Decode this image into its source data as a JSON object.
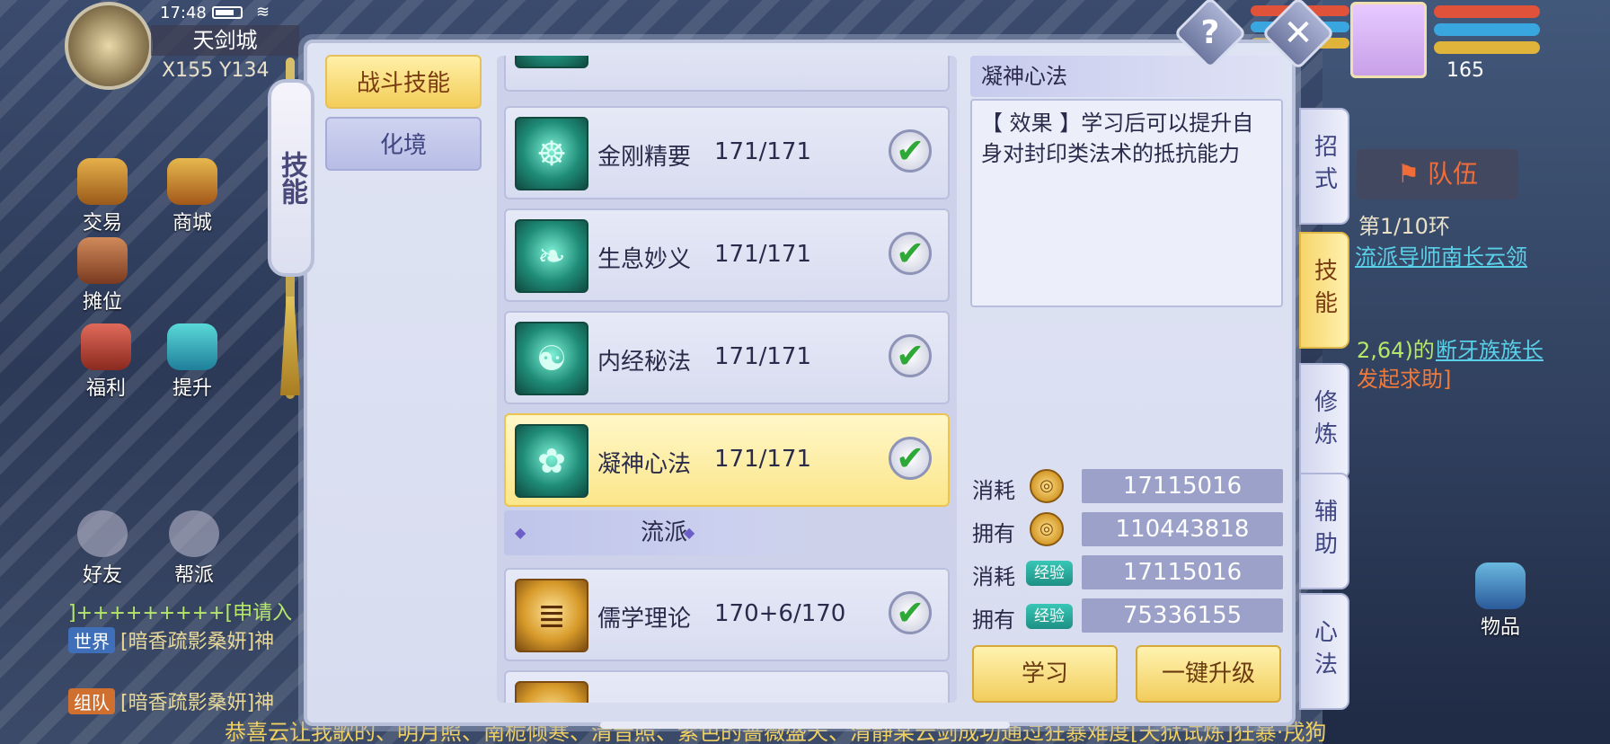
{
  "status": {
    "time": "17:48"
  },
  "map": {
    "name": "天剑城",
    "coords": "X155 Y134"
  },
  "side_buttons": {
    "trade": "交易",
    "shop": "商城",
    "stall": "摊位",
    "welfare": "福利",
    "upgrade": "提升",
    "friends": "好友",
    "guild": "帮派",
    "items": "物品"
  },
  "player": {
    "level": "165"
  },
  "team_label": "队伍",
  "quest": {
    "progress": "第1/10环",
    "npc": "流派导师南长云领",
    "coords_text": "2,64)的",
    "boss": "断牙族族长",
    "help": "发起求助]"
  },
  "chat": [
    {
      "channel": "世界",
      "text": "[暗香疏影桑妍]神"
    },
    {
      "channel": "组队",
      "text": "[暗香疏影桑妍]神"
    }
  ],
  "chat_plus_line": "]+++++++++[申请入",
  "marquee": "恭喜云让我歌的、明月照、南栀倾寒、清音照、紫色的蔷薇盛天、清静某云剑成功通过狂暴难度[天狱试炼]狂暴·戌狗",
  "panel": {
    "side_title": "技能",
    "left_tabs": [
      {
        "label": "战斗技能",
        "active": true
      },
      {
        "label": "化境",
        "active": false
      }
    ],
    "skills": [
      {
        "name": "金刚精要",
        "level": "171/171",
        "icon": "bell-icon",
        "glyph": "☸",
        "gold": false,
        "selected": false
      },
      {
        "name": "生息妙义",
        "level": "171/171",
        "icon": "leaf-icon",
        "glyph": "❧",
        "gold": false,
        "selected": false
      },
      {
        "name": "内经秘法",
        "level": "171/171",
        "icon": "meditation-icon",
        "glyph": "☯",
        "gold": false,
        "selected": false
      },
      {
        "name": "凝神心法",
        "level": "171/171",
        "icon": "lotus-icon",
        "glyph": "✿",
        "gold": false,
        "selected": true
      }
    ],
    "section_label": "流派",
    "school_skills": [
      {
        "name": "儒学理论",
        "level": "170+6/170",
        "icon": "scroll-icon",
        "glyph": "📜",
        "gold": true
      }
    ],
    "detail": {
      "title": "凝神心法",
      "description": "【 效果 】学习后可以提升自身对封印类法术的抵抗能力"
    },
    "costs": [
      {
        "label": "消耗",
        "type": "coin",
        "value": "17115016"
      },
      {
        "label": "拥有",
        "type": "coin",
        "value": "110443818"
      },
      {
        "label": "消耗",
        "type": "exp",
        "badge": "经验",
        "value": "17115016"
      },
      {
        "label": "拥有",
        "type": "exp",
        "badge": "经验",
        "value": "75336155"
      }
    ],
    "buttons": {
      "learn": "学习",
      "upgrade_all": "一键升级"
    },
    "right_tabs": [
      {
        "label": "招式",
        "active": false
      },
      {
        "label": "技能",
        "active": true
      },
      {
        "label": "修炼",
        "active": false
      },
      {
        "label": "辅助",
        "active": false
      },
      {
        "label": "心法",
        "active": false
      }
    ],
    "help_glyph": "?",
    "close_glyph": "✕"
  },
  "colors": {
    "accent_gold": "#f3cd58",
    "panel_bg": "#dfe4f4",
    "check_green": "#2ea836",
    "value_box": "#9ba1c8"
  }
}
